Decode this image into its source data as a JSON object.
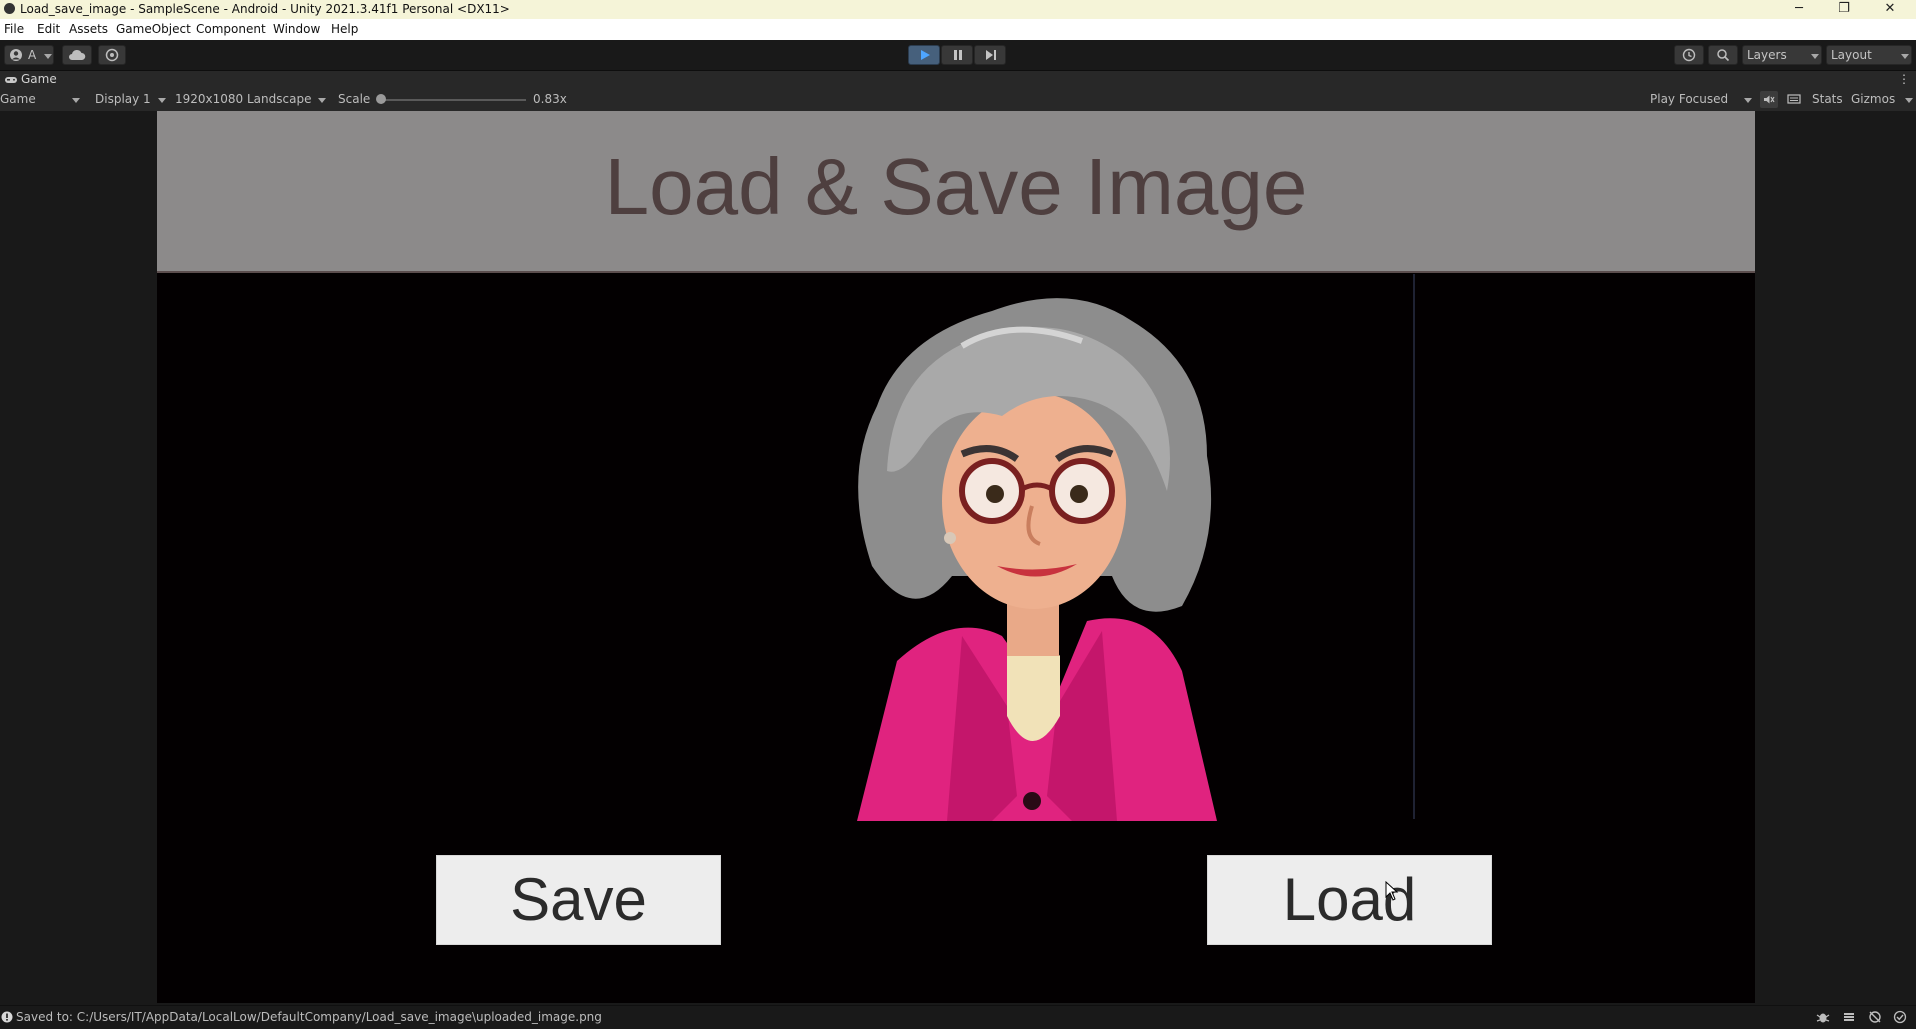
{
  "window": {
    "title": "Load_save_image - SampleScene - Android - Unity 2021.3.41f1 Personal <DX11>",
    "minimize_glyph": "─",
    "restore_glyph": "❐",
    "close_glyph": "✕"
  },
  "menu": [
    "File",
    "Edit",
    "Assets",
    "GameObject",
    "Component",
    "Window",
    "Help"
  ],
  "toolbar": {
    "account_label": "A",
    "layers_label": "Layers",
    "layout_label": "Layout"
  },
  "game_tab": {
    "label": "Game"
  },
  "game_view": {
    "view_mode": "Game",
    "display": "Display 1",
    "resolution": "1920x1080 Landscape",
    "scale_label": "Scale",
    "scale_value": "0.83x",
    "scale_fraction": 0.0,
    "play_mode": "Play Focused",
    "stats_label": "Stats",
    "gizmos_label": "Gizmos"
  },
  "game": {
    "title": "Load & Save Image",
    "save_label": "Save",
    "load_label": "Load"
  },
  "status": {
    "message": "Saved to: C:/Users/IT/AppData/LocalLow/DefaultCompany/Load_save_image\\uploaded_image.png"
  },
  "colors": {
    "header_panel": "#8c8a8a",
    "title_text": "#4e3f3f",
    "jacket": "#e0237f",
    "hair": "#9a9a9a"
  }
}
